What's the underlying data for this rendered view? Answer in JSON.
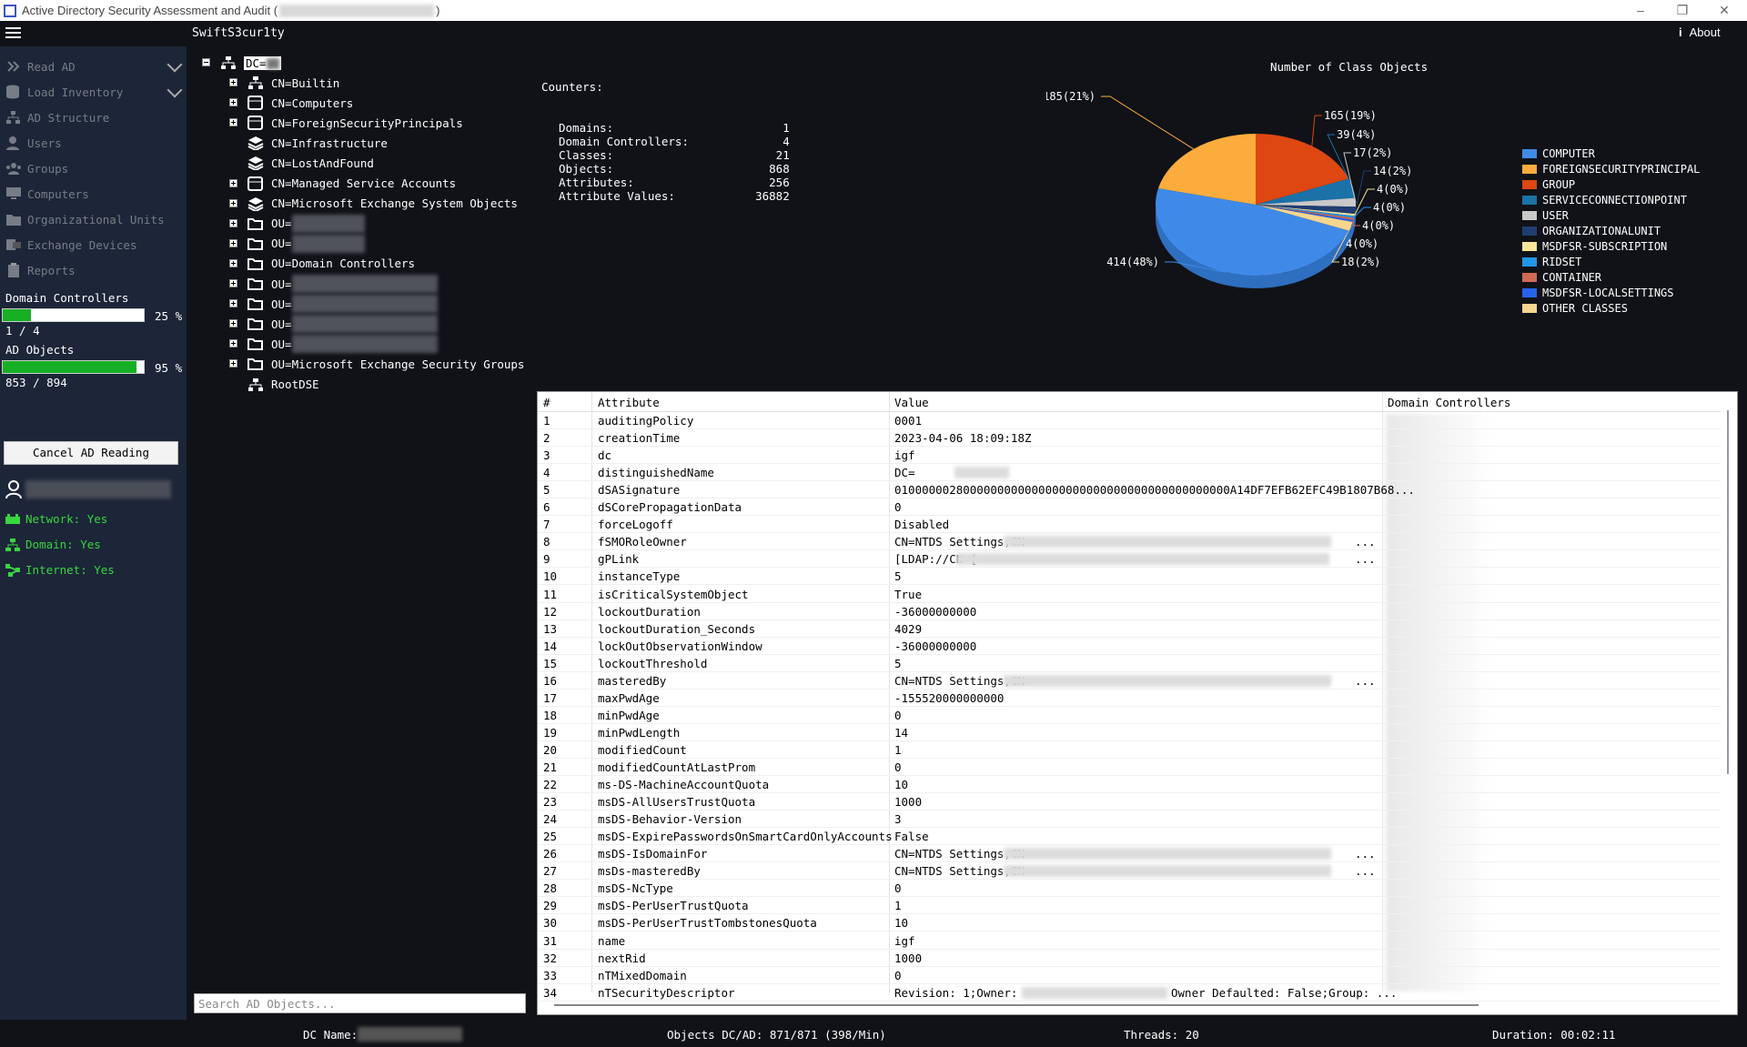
{
  "window": {
    "title": "Active Directory Security Assessment and Audit (",
    "title_suffix": ")"
  },
  "header": {
    "brand": "SwiftS3cur1ty",
    "about": "About"
  },
  "sidebar": {
    "items": [
      {
        "label": "Read AD",
        "icon": "chevrons-right-icon"
      },
      {
        "label": "Load Inventory",
        "icon": "database-icon"
      },
      {
        "label": "AD Structure",
        "icon": "sitemap-icon"
      },
      {
        "label": "Users",
        "icon": "user-icon"
      },
      {
        "label": "Groups",
        "icon": "users-icon"
      },
      {
        "label": "Computers",
        "icon": "monitor-icon"
      },
      {
        "label": "Organizational Units",
        "icon": "folder-icon"
      },
      {
        "label": "Exchange Devices",
        "icon": "exchange-icon"
      },
      {
        "label": "Reports",
        "icon": "clipboard-icon"
      }
    ],
    "dc_label": "Domain Controllers",
    "dc_percent": "25 %",
    "dc_progress": 0.2,
    "dc_count": "1 / 4",
    "obj_label": "AD Objects",
    "obj_percent": "95 %",
    "obj_progress": 0.95,
    "obj_count": "853 / 894",
    "cancel_label": "Cancel AD Reading",
    "status": [
      {
        "label": "Network: Yes",
        "icon": "network-icon"
      },
      {
        "label": "Domain: Yes",
        "icon": "domain-icon"
      },
      {
        "label": "Internet: Yes",
        "icon": "internet-icon"
      }
    ]
  },
  "tree": {
    "root": "DC=",
    "nodes": [
      {
        "label": "CN=Builtin",
        "icon": "sitemap"
      },
      {
        "label": "CN=Computers",
        "icon": "container"
      },
      {
        "label": "CN=ForeignSecurityPrincipals",
        "icon": "container"
      },
      {
        "label": "CN=Infrastructure",
        "icon": "layers"
      },
      {
        "label": "CN=LostAndFound",
        "icon": "layers"
      },
      {
        "label": "CN=Managed Service Accounts",
        "icon": "container"
      },
      {
        "label": "CN=Microsoft Exchange System Objects",
        "icon": "layers"
      },
      {
        "label": "OU=",
        "icon": "folder"
      },
      {
        "label": "OU=",
        "icon": "folder"
      },
      {
        "label": "OU=Domain Controllers",
        "icon": "folder"
      },
      {
        "label": "OU=",
        "icon": "folder"
      },
      {
        "label": "OU=",
        "icon": "folder"
      },
      {
        "label": "OU=",
        "icon": "folder"
      },
      {
        "label": "OU=",
        "icon": "folder"
      },
      {
        "label": "OU=Microsoft Exchange Security Groups",
        "icon": "folder"
      },
      {
        "label": "RootDSE",
        "icon": "sitemap"
      }
    ],
    "search_placeholder": "Search AD Objects..."
  },
  "counters": {
    "title": "Counters:",
    "items": [
      {
        "label": "Domains:",
        "value": "1"
      },
      {
        "label": "Domain Controllers:",
        "value": "4"
      },
      {
        "label": "Classes:",
        "value": "21"
      },
      {
        "label": "Objects:",
        "value": "868"
      },
      {
        "label": "Attributes:",
        "value": "256"
      },
      {
        "label": "Attribute Values:",
        "value": "36882"
      }
    ]
  },
  "chart_data": {
    "type": "pie",
    "title": "Number of Class Objects",
    "categories": [
      "COMPUTER",
      "FOREIGNSECURITYPRINCIPAL",
      "GROUP",
      "SERVICECONNECTIONPOINT",
      "USER",
      "ORGANIZATIONALUNIT",
      "MSDFSR-SUBSCRIPTION",
      "RIDSET",
      "CONTAINER",
      "MSDFSR-LOCALSETTINGS",
      "OTHER CLASSES"
    ],
    "values": [
      414,
      185,
      165,
      39,
      17,
      14,
      4,
      4,
      4,
      4,
      18
    ],
    "data_labels": [
      "414(48%)",
      "185(21%)",
      "165(19%)",
      "39(4%)",
      "17(2%)",
      "14(2%)",
      "4(0%)",
      "4(0%)",
      "4(0%)",
      "4(0%)",
      "18(2%)"
    ],
    "colors": [
      "#3f8ae8",
      "#fbac3c",
      "#de4612",
      "#1a72a8",
      "#c9c9c9",
      "#1e3e72",
      "#f7e59a",
      "#2196e8",
      "#cf6a55",
      "#2563eb",
      "#f8d58e"
    ],
    "legend": "right"
  },
  "grid": {
    "columns": [
      "#",
      "Attribute",
      "Value",
      "Domain Controllers"
    ],
    "rows": [
      [
        "1",
        "auditingPolicy",
        "0001"
      ],
      [
        "2",
        "creationTime",
        "2023-04-06 18:09:18Z"
      ],
      [
        "3",
        "dc",
        "igf"
      ],
      [
        "4",
        "distinguishedName",
        "DC="
      ],
      [
        "5",
        "dSASignature",
        "0100000028000000000000000000000000000000000000000A14DF7EFB62EFC49B1807B68..."
      ],
      [
        "6",
        "dSCorePropagationData",
        "0"
      ],
      [
        "7",
        "forceLogoff",
        "Disabled"
      ],
      [
        "8",
        "fSMORoleOwner",
        "CN=NTDS Settings,CN="
      ],
      [
        "9",
        "gPLink",
        "[LDAP://CN={"
      ],
      [
        "10",
        "instanceType",
        "5"
      ],
      [
        "11",
        "isCriticalSystemObject",
        "True"
      ],
      [
        "12",
        "lockoutDuration",
        "-36000000000"
      ],
      [
        "13",
        "lockoutDuration_Seconds",
        "4029"
      ],
      [
        "14",
        "lockOutObservationWindow",
        "-36000000000"
      ],
      [
        "15",
        "lockoutThreshold",
        "5"
      ],
      [
        "16",
        "masteredBy",
        "CN=NTDS Settings,CN="
      ],
      [
        "17",
        "maxPwdAge",
        "-155520000000000"
      ],
      [
        "18",
        "minPwdAge",
        "0"
      ],
      [
        "19",
        "minPwdLength",
        "14"
      ],
      [
        "20",
        "modifiedCount",
        "1"
      ],
      [
        "21",
        "modifiedCountAtLastProm",
        "0"
      ],
      [
        "22",
        "ms-DS-MachineAccountQuota",
        "10"
      ],
      [
        "23",
        "msDS-AllUsersTrustQuota",
        "1000"
      ],
      [
        "24",
        "msDS-Behavior-Version",
        "3"
      ],
      [
        "25",
        "msDS-ExpirePasswordsOnSmartCardOnlyAccounts",
        "False"
      ],
      [
        "26",
        "msDS-IsDomainFor",
        "CN=NTDS Settings,CN="
      ],
      [
        "27",
        "msDs-masteredBy",
        "CN=NTDS Settings,CN="
      ],
      [
        "28",
        "msDS-NcType",
        "0"
      ],
      [
        "29",
        "msDS-PerUserTrustQuota",
        "1"
      ],
      [
        "30",
        "msDS-PerUserTrustTombstonesQuota",
        "10"
      ],
      [
        "31",
        "name",
        "igf"
      ],
      [
        "32",
        "nextRid",
        "1000"
      ],
      [
        "33",
        "nTMixedDomain",
        "0"
      ],
      [
        "34",
        "nTSecurityDescriptor",
        "Revision: 1;Owner:"
      ]
    ],
    "ellipsis": "...",
    "row34_tail": "Owner Defaulted: False;Group: ..."
  },
  "footer": {
    "dc_name_label": "DC Name:",
    "objects": "Objects DC/AD: 871/871 (398/Min)",
    "threads": "Threads: 20",
    "duration": "Duration: 00:02:11"
  }
}
